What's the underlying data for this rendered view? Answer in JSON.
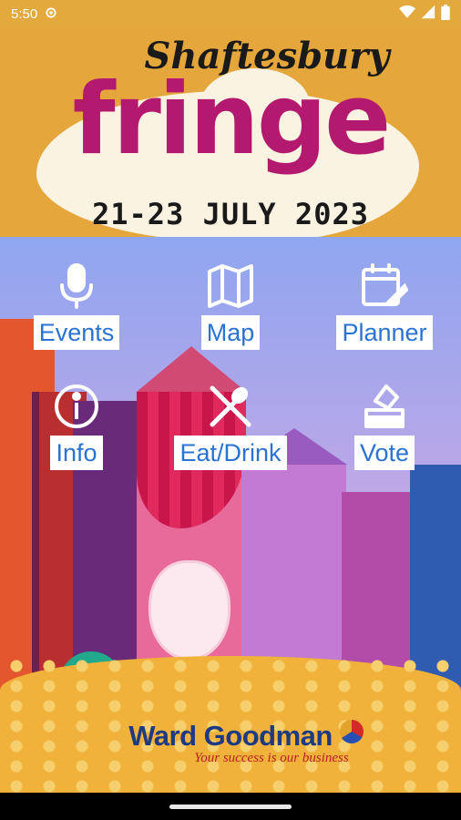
{
  "status_bar": {
    "time": "5:50",
    "icons": [
      "gear-icon",
      "wifi-icon",
      "signal-icon",
      "battery-icon"
    ]
  },
  "banner": {
    "title_top": "Shaftesbury",
    "title_main": "fringe",
    "dates": "21-23 JULY 2023"
  },
  "menu": {
    "items": [
      {
        "label": "Events",
        "icon": "microphone-icon"
      },
      {
        "label": "Map",
        "icon": "map-icon"
      },
      {
        "label": "Planner",
        "icon": "calendar-edit-icon"
      },
      {
        "label": "Info",
        "icon": "info-icon"
      },
      {
        "label": "Eat/Drink",
        "icon": "fork-spoon-icon"
      },
      {
        "label": "Vote",
        "icon": "ballot-box-icon"
      }
    ]
  },
  "sponsor": {
    "name": "Ward Goodman",
    "tagline": "Your success is our business"
  },
  "colors": {
    "accent_label": "#2a73d2",
    "banner_bg": "#e5a63b",
    "fringe_magenta": "#b3196e",
    "sponsor_blue": "#1d3a83"
  }
}
